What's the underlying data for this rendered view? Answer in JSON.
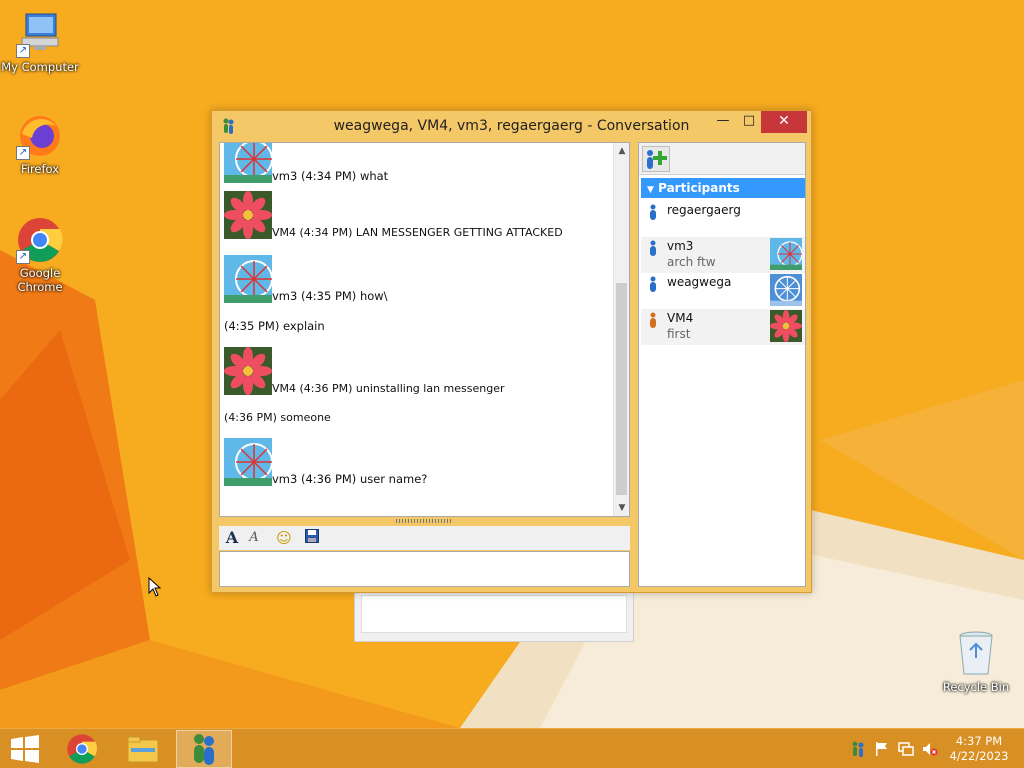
{
  "desktop": {
    "icons": [
      {
        "label": "My Computer",
        "icon": "computer-icon"
      },
      {
        "label": "Firefox",
        "icon": "firefox-icon"
      },
      {
        "label": "Google Chrome",
        "icon": "chrome-icon"
      }
    ],
    "recycle_bin_label": "Recycle Bin"
  },
  "window": {
    "title": "weagwega, VM4, vm3, regaergaerg - Conversation",
    "minimize": "—",
    "maximize": "□",
    "close": "✕"
  },
  "messages": [
    {
      "kind": "avatar",
      "avatar": "ferris-wheel",
      "text": "vm3 (4:34 PM) what"
    },
    {
      "kind": "avatar",
      "avatar": "flower",
      "text": "VM4 (4:34 PM) LAN MESSENGER GETTING ATTACKED"
    },
    {
      "kind": "avatar",
      "avatar": "ferris-wheel",
      "text": "vm3 (4:35 PM) how\\"
    },
    {
      "kind": "line",
      "text": "(4:35 PM) explain"
    },
    {
      "kind": "avatar",
      "avatar": "flower",
      "text": "VM4 (4:36 PM) uninstalling lan messenger"
    },
    {
      "kind": "line",
      "text": "(4:36 PM) someone"
    },
    {
      "kind": "avatar",
      "avatar": "ferris-wheel",
      "text": "vm3 (4:36 PM) user name?"
    }
  ],
  "format_toolbar": {
    "font_icon": "A",
    "font_color_icon": "A",
    "emoticon_icon": "☺",
    "save_icon": "save-icon"
  },
  "participants": {
    "header": "Participants",
    "items": [
      {
        "name": "regaergaerg",
        "note": "",
        "status_color": "#2a6fc9",
        "pic": ""
      },
      {
        "name": "vm3",
        "note": "arch ftw",
        "status_color": "#2a6fc9",
        "pic": "ferris-wheel"
      },
      {
        "name": "weagwega",
        "note": "",
        "status_color": "#2a6fc9",
        "pic": "ferris-wheel-blue"
      },
      {
        "name": "VM4",
        "note": "first",
        "status_color": "#d0701f",
        "pic": "flower"
      }
    ]
  },
  "taskbar": {
    "time": "4:37 PM",
    "date": "4/22/2023"
  },
  "colors": {
    "desktop": "#f6a51c",
    "taskbar": "#d88f23",
    "window_frame": "#f4c767",
    "close_button": "#c7373a",
    "participants_header": "#3399ff"
  }
}
